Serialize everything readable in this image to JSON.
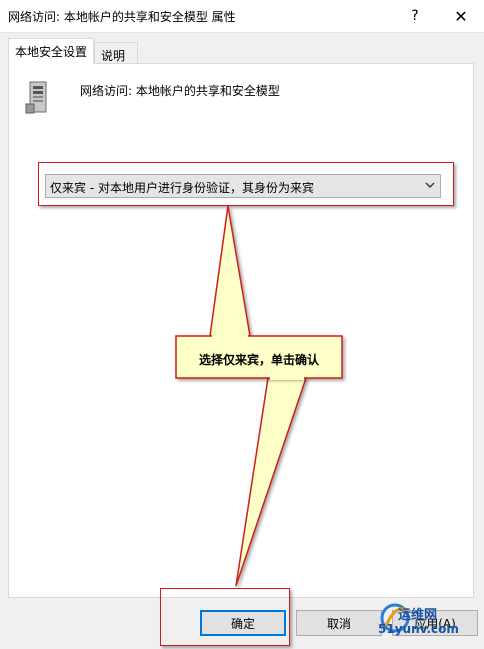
{
  "window": {
    "title": "网络访问: 本地帐户的共享和安全模型 属性",
    "help_glyph": "?",
    "close_glyph": "✕"
  },
  "tabs": [
    {
      "label": "本地安全设置",
      "active": true
    },
    {
      "label": "说明",
      "active": false
    }
  ],
  "policy": {
    "icon": "server-icon",
    "name": "网络访问: 本地帐户的共享和安全模型"
  },
  "dropdown": {
    "selected": "仅来宾 - 对本地用户进行身份验证，其身份为来宾",
    "arrow_icon": "chevron-down-icon"
  },
  "annotation": {
    "callout_text": "选择仅来宾，单击确认",
    "highlight_color": "#d11c1c",
    "callout_fill": "#ffffc8"
  },
  "buttons": {
    "ok": "确定",
    "cancel": "取消",
    "apply": "应用(A)"
  },
  "watermark": {
    "line1": "运维网",
    "line2": "51yunv.com"
  },
  "colors": {
    "accent": "#0078d7",
    "background": "#f0f0f0"
  }
}
